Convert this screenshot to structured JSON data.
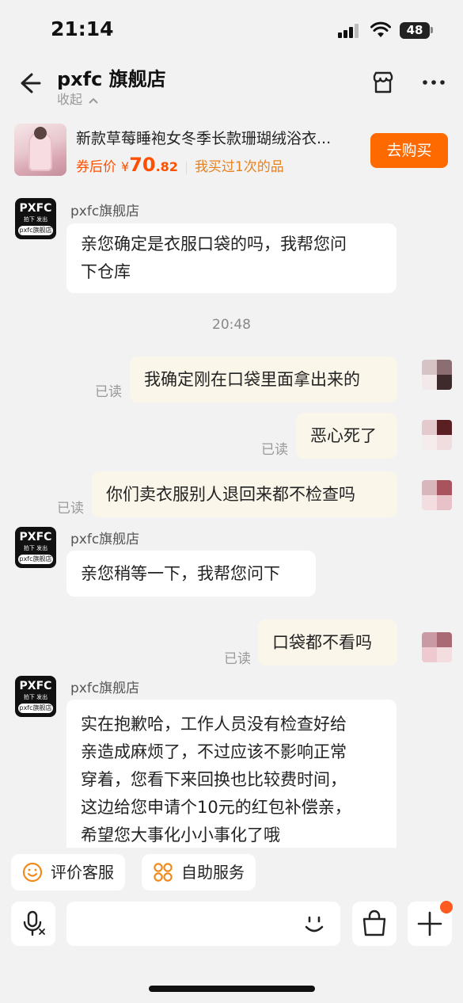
{
  "status_bar": {
    "time": "21:14",
    "battery": "48"
  },
  "header": {
    "store_name": "pxfc 旗舰店",
    "collapse_label": "收起"
  },
  "product": {
    "title": "新款草莓睡袍女冬季长款珊瑚绒浴衣...",
    "price_label": "券后价",
    "currency": "¥",
    "price_int": "70",
    "price_dec": ".82",
    "bought_note": "我买过1次的品",
    "buy_label": "去购买"
  },
  "store_avatar": {
    "logo": "PXFC",
    "tagline": "拍下 发出",
    "sub": "pxfc旗舰店"
  },
  "messages": [
    {
      "side": "in",
      "sender": "pxfc旗舰店",
      "lines": [
        "亲您确定是衣服口袋的吗，我帮您问",
        "下仓库"
      ]
    },
    {
      "type": "time",
      "text": "20:48"
    },
    {
      "side": "out",
      "text": "我确定刚在口袋里面拿出来的",
      "read": "已读"
    },
    {
      "side": "out",
      "text": "恶心死了",
      "read": "已读"
    },
    {
      "side": "out",
      "text": "你们卖衣服别人退回来都不检查吗",
      "read": "已读"
    },
    {
      "side": "in",
      "sender": "pxfc旗舰店",
      "lines": [
        "亲您稍等一下，我帮您问下"
      ]
    },
    {
      "side": "out",
      "text": "口袋都不看吗",
      "read": "已读"
    },
    {
      "side": "in",
      "sender": "pxfc旗舰店",
      "lines": [
        "实在抱歉哈，工作人员没有检查好给",
        "亲造成麻烦了，不过应该不影响正常",
        "穿着，您看下来回换也比较费时间，",
        "这边给您申请个10元的红包补偿亲，",
        "希望您大事化小小事化了哦"
      ]
    }
  ],
  "quick_actions": {
    "rate_service": "评价客服",
    "self_service": "自助服务"
  },
  "input": {
    "placeholder": ""
  },
  "colors": {
    "accent": "#ff6a00",
    "price": "#ff5000",
    "bubble_out": "#fbf6ea",
    "background": "#f2f2f2"
  },
  "icons": [
    "back-arrow-icon",
    "shop-icon",
    "more-icon",
    "smile-icon",
    "grid-icon",
    "mic-icon",
    "emoji-icon",
    "bag-icon",
    "plus-icon"
  ]
}
